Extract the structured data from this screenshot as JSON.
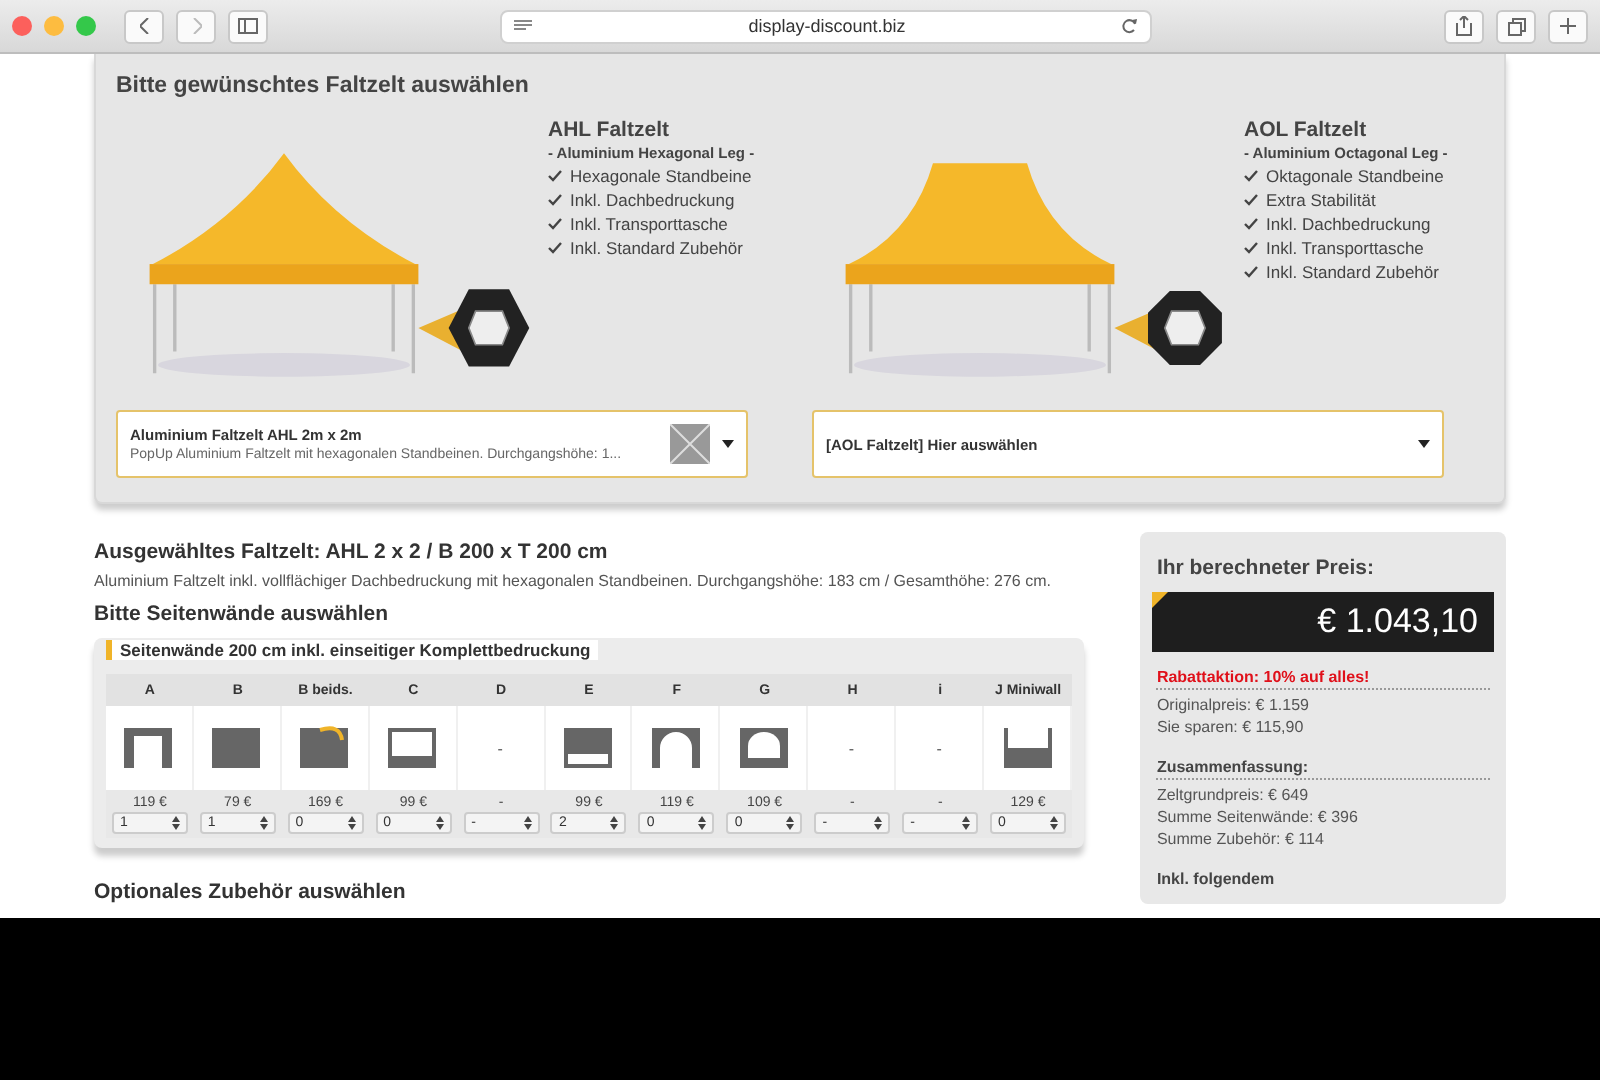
{
  "browser": {
    "url": "display-discount.biz"
  },
  "tent_panel": {
    "title": "Bitte gewünschtes Faltzelt auswählen",
    "tents": [
      {
        "kind": "hex",
        "name": "AHL Faltzelt",
        "subtitle": "- Aluminium Hexagonal Leg -",
        "features": [
          "Hexagonale Standbeine",
          "Inkl. Dachbedruckung",
          "Inkl. Transporttasche",
          "Inkl. Standard Zubehör"
        ],
        "select": {
          "title": "Aluminium Faltzelt AHL 2m x 2m",
          "subtitle": "PopUp Aluminium Faltzelt mit hexagonalen Standbeinen. Durchgangshöhe: 1...",
          "has_thumb": true
        }
      },
      {
        "kind": "oct",
        "name": "AOL Faltzelt",
        "subtitle": "- Aluminium Octagonal Leg -",
        "features": [
          "Oktagonale Standbeine",
          "Extra Stabilität",
          "Inkl. Dachbedruckung",
          "Inkl. Transporttasche",
          "Inkl. Standard Zubehör"
        ],
        "select": {
          "title": "[AOL Faltzelt] Hier auswählen",
          "has_thumb": false
        }
      }
    ]
  },
  "selected_tent": {
    "title": "Ausgewähltes Faltzelt: AHL 2 x 2 / B 200 x T 200 cm",
    "description": "Aluminium Faltzelt inkl. vollflächiger Dachbedruckung mit hexagonalen Standbeinen. Durchgangshöhe: 183 cm / Gesamthöhe: 276 cm."
  },
  "walls_heading": "Bitte Seitenwände auswählen",
  "walls": {
    "title": "Seitenwände 200 cm inkl. einseitiger Komplettbedruckung",
    "columns": [
      {
        "label": "A",
        "kind": "door",
        "price": "119 €",
        "qty": "1"
      },
      {
        "label": "B",
        "kind": "solid",
        "price": "79 €",
        "qty": "1"
      },
      {
        "label": "B beids.",
        "kind": "double",
        "price": "169 €",
        "qty": "0"
      },
      {
        "label": "C",
        "kind": "window",
        "price": "99 €",
        "qty": "0"
      },
      {
        "label": "D",
        "kind": "none",
        "placeholder": "-",
        "price": "-",
        "qty": "-"
      },
      {
        "label": "E",
        "kind": "lowwindow",
        "price": "99 €",
        "qty": "2"
      },
      {
        "label": "F",
        "kind": "arch",
        "price": "119 €",
        "qty": "0"
      },
      {
        "label": "G",
        "kind": "archwindow",
        "price": "109 €",
        "qty": "0"
      },
      {
        "label": "H",
        "kind": "none",
        "placeholder": "-",
        "price": "-",
        "qty": "-"
      },
      {
        "label": "i",
        "kind": "none",
        "placeholder": "-",
        "price": "-",
        "qty": "-"
      },
      {
        "label": "J Miniwall",
        "kind": "half",
        "price": "129 €",
        "qty": "0"
      }
    ]
  },
  "accessories_heading": "Optionales Zubehör auswählen",
  "price_panel": {
    "title": "Ihr berechneter Preis:",
    "price": "€ 1.043,10",
    "promo": "Rabattaktion: 10% auf alles!",
    "savings": [
      "Originalpreis: € 1.159",
      "Sie sparen: € 115,90"
    ],
    "summary_title": "Zusammenfassung:",
    "summary": [
      "Zeltgrundpreis: € 649",
      "Summe Seitenwände: € 396",
      "Summe Zubehör: € 114"
    ],
    "included_title": "Inkl. folgendem"
  }
}
